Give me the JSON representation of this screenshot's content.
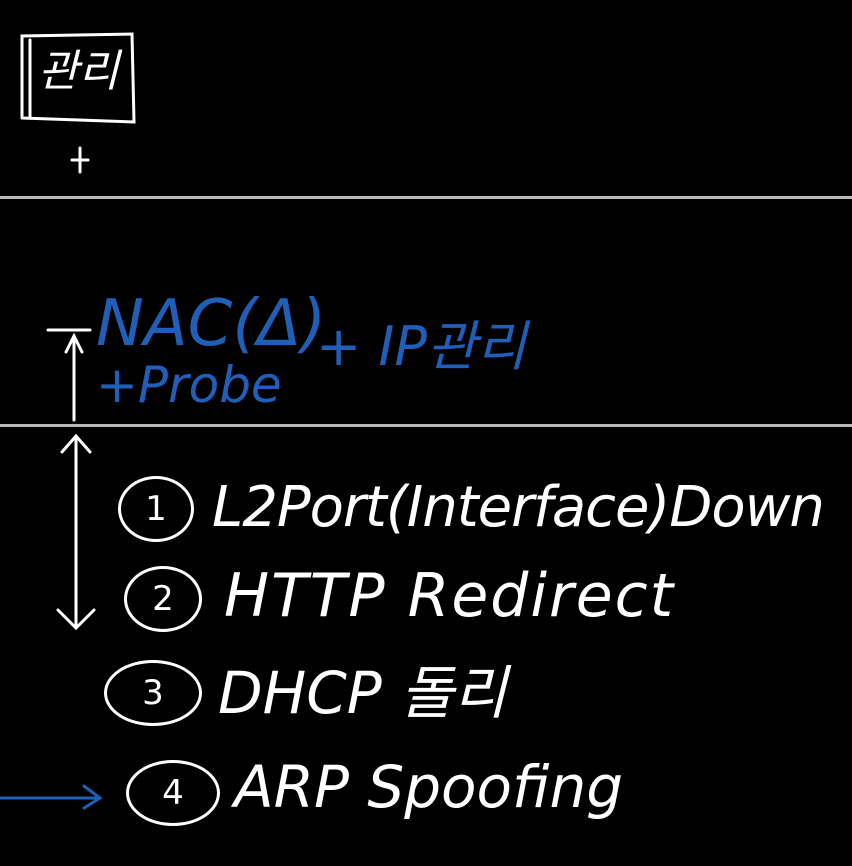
{
  "top_box_label": "관리",
  "plus_sign": "+",
  "nac_line": "NAC(Δ)",
  "ip_label": "+ IP관리",
  "probe_line": "+Probe",
  "items": [
    {
      "number": "1",
      "text": "L2Port(Interface)Down"
    },
    {
      "number": "2",
      "text": "HTTP Redirect"
    },
    {
      "number": "3",
      "text": "DHCP 돌리"
    },
    {
      "number": "4",
      "text": "ARP Spoofing"
    }
  ],
  "colors": {
    "background": "#000000",
    "ink": "#ffffff",
    "blue_ink": "#1f5fb8",
    "rule": "#b9b9b9"
  }
}
